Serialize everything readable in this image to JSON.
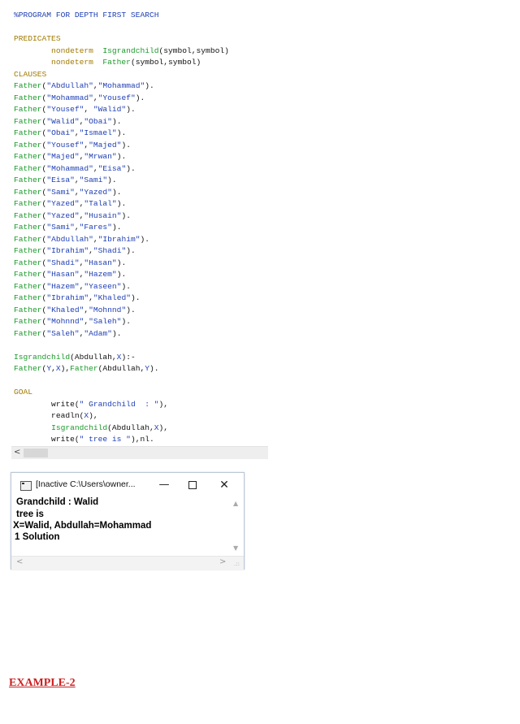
{
  "editor": {
    "lines": [
      {
        "parts": [
          {
            "cls": "c-comment",
            "text": "%PROGRAM FOR DEPTH FIRST SEARCH"
          }
        ]
      },
      {
        "parts": [
          {
            "cls": "c-plain",
            "text": ""
          }
        ]
      },
      {
        "parts": [
          {
            "cls": "c-kw",
            "text": "PREDICATES"
          }
        ]
      },
      {
        "parts": [
          {
            "cls": "c-kw",
            "text": "        nondeterm  "
          },
          {
            "cls": "c-pred",
            "text": "Isgrandchild"
          },
          {
            "cls": "c-plain",
            "text": "(symbol,symbol)"
          }
        ]
      },
      {
        "parts": [
          {
            "cls": "c-kw",
            "text": "        nondeterm  "
          },
          {
            "cls": "c-pred",
            "text": "Father"
          },
          {
            "cls": "c-plain",
            "text": "(symbol,symbol)"
          }
        ]
      },
      {
        "parts": [
          {
            "cls": "c-kw",
            "text": "CLAUSES"
          }
        ]
      },
      {
        "parts": [
          {
            "cls": "c-pred",
            "text": "Father"
          },
          {
            "cls": "c-plain",
            "text": "("
          },
          {
            "cls": "c-str",
            "text": "\"Abdullah\""
          },
          {
            "cls": "c-plain",
            "text": ","
          },
          {
            "cls": "c-str",
            "text": "\"Mohammad\""
          },
          {
            "cls": "c-plain",
            "text": ")."
          }
        ]
      },
      {
        "parts": [
          {
            "cls": "c-pred",
            "text": "Father"
          },
          {
            "cls": "c-plain",
            "text": "("
          },
          {
            "cls": "c-str",
            "text": "\"Mohammad\""
          },
          {
            "cls": "c-plain",
            "text": ","
          },
          {
            "cls": "c-str",
            "text": "\"Yousef\""
          },
          {
            "cls": "c-plain",
            "text": ")."
          }
        ]
      },
      {
        "parts": [
          {
            "cls": "c-pred",
            "text": "Father"
          },
          {
            "cls": "c-plain",
            "text": "("
          },
          {
            "cls": "c-str",
            "text": "\"Yousef\""
          },
          {
            "cls": "c-plain",
            "text": ", "
          },
          {
            "cls": "c-str",
            "text": "\"Walid\""
          },
          {
            "cls": "c-plain",
            "text": ")."
          }
        ]
      },
      {
        "parts": [
          {
            "cls": "c-pred",
            "text": "Father"
          },
          {
            "cls": "c-plain",
            "text": "("
          },
          {
            "cls": "c-str",
            "text": "\"Walid\""
          },
          {
            "cls": "c-plain",
            "text": ","
          },
          {
            "cls": "c-str",
            "text": "\"Obai\""
          },
          {
            "cls": "c-plain",
            "text": ")."
          }
        ]
      },
      {
        "parts": [
          {
            "cls": "c-pred",
            "text": "Father"
          },
          {
            "cls": "c-plain",
            "text": "("
          },
          {
            "cls": "c-str",
            "text": "\"Obai\""
          },
          {
            "cls": "c-plain",
            "text": ","
          },
          {
            "cls": "c-str",
            "text": "\"Ismael\""
          },
          {
            "cls": "c-plain",
            "text": ")."
          }
        ]
      },
      {
        "parts": [
          {
            "cls": "c-pred",
            "text": "Father"
          },
          {
            "cls": "c-plain",
            "text": "("
          },
          {
            "cls": "c-str",
            "text": "\"Yousef\""
          },
          {
            "cls": "c-plain",
            "text": ","
          },
          {
            "cls": "c-str",
            "text": "\"Majed\""
          },
          {
            "cls": "c-plain",
            "text": ")."
          }
        ]
      },
      {
        "parts": [
          {
            "cls": "c-pred",
            "text": "Father"
          },
          {
            "cls": "c-plain",
            "text": "("
          },
          {
            "cls": "c-str",
            "text": "\"Majed\""
          },
          {
            "cls": "c-plain",
            "text": ","
          },
          {
            "cls": "c-str",
            "text": "\"Mrwan\""
          },
          {
            "cls": "c-plain",
            "text": ")."
          }
        ]
      },
      {
        "parts": [
          {
            "cls": "c-pred",
            "text": "Father"
          },
          {
            "cls": "c-plain",
            "text": "("
          },
          {
            "cls": "c-str",
            "text": "\"Mohammad\""
          },
          {
            "cls": "c-plain",
            "text": ","
          },
          {
            "cls": "c-str",
            "text": "\"Eisa\""
          },
          {
            "cls": "c-plain",
            "text": ")."
          }
        ]
      },
      {
        "parts": [
          {
            "cls": "c-pred",
            "text": "Father"
          },
          {
            "cls": "c-plain",
            "text": "("
          },
          {
            "cls": "c-str",
            "text": "\"Eisa\""
          },
          {
            "cls": "c-plain",
            "text": ","
          },
          {
            "cls": "c-str",
            "text": "\"Sami\""
          },
          {
            "cls": "c-plain",
            "text": ")."
          }
        ]
      },
      {
        "parts": [
          {
            "cls": "c-pred",
            "text": "Father"
          },
          {
            "cls": "c-plain",
            "text": "("
          },
          {
            "cls": "c-str",
            "text": "\"Sami\""
          },
          {
            "cls": "c-plain",
            "text": ","
          },
          {
            "cls": "c-str",
            "text": "\"Yazed\""
          },
          {
            "cls": "c-plain",
            "text": ")."
          }
        ]
      },
      {
        "parts": [
          {
            "cls": "c-pred",
            "text": "Father"
          },
          {
            "cls": "c-plain",
            "text": "("
          },
          {
            "cls": "c-str",
            "text": "\"Yazed\""
          },
          {
            "cls": "c-plain",
            "text": ","
          },
          {
            "cls": "c-str",
            "text": "\"Talal\""
          },
          {
            "cls": "c-plain",
            "text": ")."
          }
        ]
      },
      {
        "parts": [
          {
            "cls": "c-pred",
            "text": "Father"
          },
          {
            "cls": "c-plain",
            "text": "("
          },
          {
            "cls": "c-str",
            "text": "\"Yazed\""
          },
          {
            "cls": "c-plain",
            "text": ","
          },
          {
            "cls": "c-str",
            "text": "\"Husain\""
          },
          {
            "cls": "c-plain",
            "text": ")."
          }
        ]
      },
      {
        "parts": [
          {
            "cls": "c-pred",
            "text": "Father"
          },
          {
            "cls": "c-plain",
            "text": "("
          },
          {
            "cls": "c-str",
            "text": "\"Sami\""
          },
          {
            "cls": "c-plain",
            "text": ","
          },
          {
            "cls": "c-str",
            "text": "\"Fares\""
          },
          {
            "cls": "c-plain",
            "text": ")."
          }
        ]
      },
      {
        "parts": [
          {
            "cls": "c-pred",
            "text": "Father"
          },
          {
            "cls": "c-plain",
            "text": "("
          },
          {
            "cls": "c-str",
            "text": "\"Abdullah\""
          },
          {
            "cls": "c-plain",
            "text": ","
          },
          {
            "cls": "c-str",
            "text": "\"Ibrahim\""
          },
          {
            "cls": "c-plain",
            "text": ")."
          }
        ]
      },
      {
        "parts": [
          {
            "cls": "c-pred",
            "text": "Father"
          },
          {
            "cls": "c-plain",
            "text": "("
          },
          {
            "cls": "c-str",
            "text": "\"Ibrahim\""
          },
          {
            "cls": "c-plain",
            "text": ","
          },
          {
            "cls": "c-str",
            "text": "\"Shadi\""
          },
          {
            "cls": "c-plain",
            "text": ")."
          }
        ]
      },
      {
        "parts": [
          {
            "cls": "c-pred",
            "text": "Father"
          },
          {
            "cls": "c-plain",
            "text": "("
          },
          {
            "cls": "c-str",
            "text": "\"Shadi\""
          },
          {
            "cls": "c-plain",
            "text": ","
          },
          {
            "cls": "c-str",
            "text": "\"Hasan\""
          },
          {
            "cls": "c-plain",
            "text": ")."
          }
        ]
      },
      {
        "parts": [
          {
            "cls": "c-pred",
            "text": "Father"
          },
          {
            "cls": "c-plain",
            "text": "("
          },
          {
            "cls": "c-str",
            "text": "\"Hasan\""
          },
          {
            "cls": "c-plain",
            "text": ","
          },
          {
            "cls": "c-str",
            "text": "\"Hazem\""
          },
          {
            "cls": "c-plain",
            "text": ")."
          }
        ]
      },
      {
        "parts": [
          {
            "cls": "c-pred",
            "text": "Father"
          },
          {
            "cls": "c-plain",
            "text": "("
          },
          {
            "cls": "c-str",
            "text": "\"Hazem\""
          },
          {
            "cls": "c-plain",
            "text": ","
          },
          {
            "cls": "c-str",
            "text": "\"Yaseen\""
          },
          {
            "cls": "c-plain",
            "text": ")."
          }
        ]
      },
      {
        "parts": [
          {
            "cls": "c-pred",
            "text": "Father"
          },
          {
            "cls": "c-plain",
            "text": "("
          },
          {
            "cls": "c-str",
            "text": "\"Ibrahim\""
          },
          {
            "cls": "c-plain",
            "text": ","
          },
          {
            "cls": "c-str",
            "text": "\"Khaled\""
          },
          {
            "cls": "c-plain",
            "text": ")."
          }
        ]
      },
      {
        "parts": [
          {
            "cls": "c-pred",
            "text": "Father"
          },
          {
            "cls": "c-plain",
            "text": "("
          },
          {
            "cls": "c-str",
            "text": "\"Khaled\""
          },
          {
            "cls": "c-plain",
            "text": ","
          },
          {
            "cls": "c-str",
            "text": "\"Mohnnd\""
          },
          {
            "cls": "c-plain",
            "text": ")."
          }
        ]
      },
      {
        "parts": [
          {
            "cls": "c-pred",
            "text": "Father"
          },
          {
            "cls": "c-plain",
            "text": "("
          },
          {
            "cls": "c-str",
            "text": "\"Mohnnd\""
          },
          {
            "cls": "c-plain",
            "text": ","
          },
          {
            "cls": "c-str",
            "text": "\"Saleh\""
          },
          {
            "cls": "c-plain",
            "text": ")."
          }
        ]
      },
      {
        "parts": [
          {
            "cls": "c-pred",
            "text": "Father"
          },
          {
            "cls": "c-plain",
            "text": "("
          },
          {
            "cls": "c-str",
            "text": "\"Saleh\""
          },
          {
            "cls": "c-plain",
            "text": ","
          },
          {
            "cls": "c-str",
            "text": "\"Adam\""
          },
          {
            "cls": "c-plain",
            "text": ")."
          }
        ]
      },
      {
        "parts": [
          {
            "cls": "c-plain",
            "text": ""
          }
        ]
      },
      {
        "parts": [
          {
            "cls": "c-pred",
            "text": "Isgrandchild"
          },
          {
            "cls": "c-plain",
            "text": "(Abdullah,"
          },
          {
            "cls": "c-var",
            "text": "X"
          },
          {
            "cls": "c-plain",
            "text": "):-"
          }
        ]
      },
      {
        "parts": [
          {
            "cls": "c-pred",
            "text": "Father"
          },
          {
            "cls": "c-plain",
            "text": "("
          },
          {
            "cls": "c-var",
            "text": "Y"
          },
          {
            "cls": "c-plain",
            "text": ","
          },
          {
            "cls": "c-var",
            "text": "X"
          },
          {
            "cls": "c-plain",
            "text": "),"
          },
          {
            "cls": "c-pred",
            "text": "Father"
          },
          {
            "cls": "c-plain",
            "text": "(Abdullah,"
          },
          {
            "cls": "c-var",
            "text": "Y"
          },
          {
            "cls": "c-plain",
            "text": ")."
          }
        ]
      },
      {
        "parts": [
          {
            "cls": "c-plain",
            "text": ""
          }
        ]
      },
      {
        "parts": [
          {
            "cls": "c-kw",
            "text": "GOAL"
          }
        ]
      },
      {
        "parts": [
          {
            "cls": "c-plain",
            "text": "        write("
          },
          {
            "cls": "c-str",
            "text": "\" Grandchild  : \""
          },
          {
            "cls": "c-plain",
            "text": "),"
          }
        ]
      },
      {
        "parts": [
          {
            "cls": "c-plain",
            "text": "        readln("
          },
          {
            "cls": "c-var",
            "text": "X"
          },
          {
            "cls": "c-plain",
            "text": "),"
          }
        ]
      },
      {
        "parts": [
          {
            "cls": "c-plain",
            "text": "        "
          },
          {
            "cls": "c-pred",
            "text": "Isgrandchild"
          },
          {
            "cls": "c-plain",
            "text": "(Abdullah,"
          },
          {
            "cls": "c-var",
            "text": "X"
          },
          {
            "cls": "c-plain",
            "text": "),"
          }
        ]
      },
      {
        "parts": [
          {
            "cls": "c-plain",
            "text": "        write("
          },
          {
            "cls": "c-str",
            "text": "\" tree is \""
          },
          {
            "cls": "c-plain",
            "text": "),nl."
          }
        ]
      }
    ],
    "hscroll_left_glyph": "<"
  },
  "console": {
    "title": "[Inactive C:\\Users\\owner...",
    "min_glyph": "—",
    "close_glyph": "✕",
    "output_lines": [
      {
        "text": " Grandchild  : Walid"
      },
      {
        "text": " tree is"
      },
      {
        "text": "X=Walid, Abdullah=Mohammad"
      },
      {
        "text": "1 Solution"
      }
    ],
    "scroll_up_glyph": "▲",
    "scroll_down_glyph": "▼",
    "scroll_left_glyph": "<",
    "scroll_right_glyph": ">",
    "grip_glyph": ".::"
  },
  "footer": {
    "example_label": "EXAMPLE-2"
  },
  "colors": {
    "comment": "#1f3fb3",
    "keyword": "#a07a00",
    "predicate": "#1a9a2a",
    "example_heading": "#cc1f1f"
  }
}
